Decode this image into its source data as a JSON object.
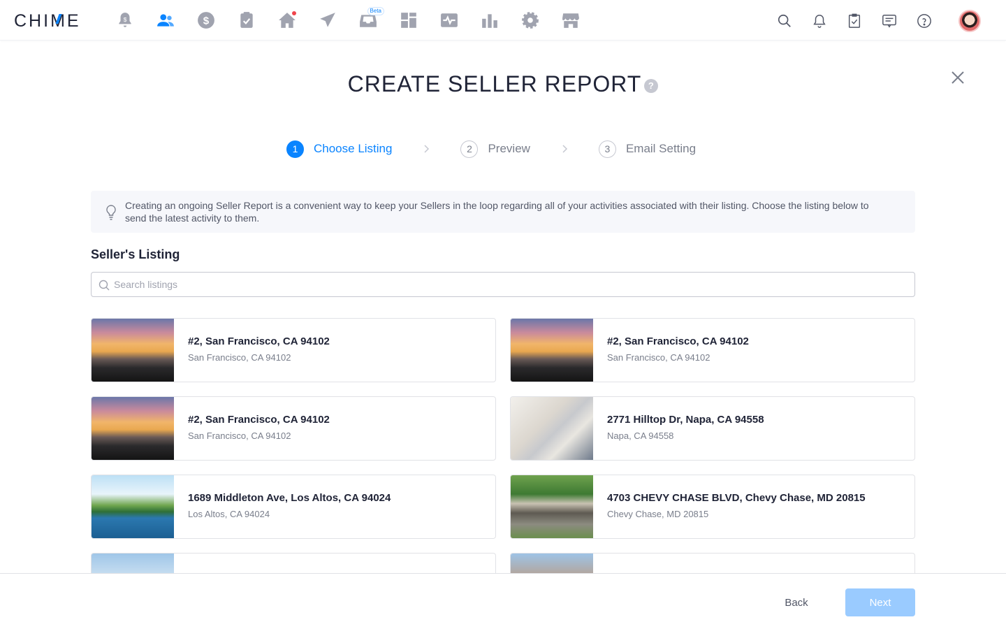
{
  "nav": {
    "logo": "CHIME",
    "icons": [
      "bell-dollar-icon",
      "people-icon",
      "dollar-icon",
      "clipboard-icon",
      "home-icon",
      "send-icon",
      "inbox-icon",
      "dashboard-icon",
      "activity-icon",
      "bar-chart-icon",
      "gear-icon",
      "store-icon"
    ],
    "beta_label": "Beta",
    "active_icon": "people-icon",
    "right_icons": [
      "search-icon",
      "bell-icon",
      "task-icon",
      "message-icon",
      "help-icon"
    ],
    "accent_color": "#0a84ff"
  },
  "header": {
    "title": "CREATE SELLER REPORT",
    "help_glyph": "?"
  },
  "steps": [
    {
      "num": "1",
      "label": "Choose Listing",
      "active": true
    },
    {
      "num": "2",
      "label": "Preview",
      "active": false
    },
    {
      "num": "3",
      "label": "Email Setting",
      "active": false
    }
  ],
  "info": {
    "text": "Creating an ongoing Seller Report is a convenient way to keep your Sellers in the loop regarding all of your activities associated with their listing. Choose the listing below to send the latest activity to them."
  },
  "listing_section": {
    "title": "Seller's Listing",
    "search_placeholder": "Search listings"
  },
  "listings": [
    {
      "address": "#2, San Francisco, CA 94102",
      "city": "San Francisco, CA 94102",
      "image": "sunset"
    },
    {
      "address": "#2, San Francisco, CA 94102",
      "city": "San Francisco, CA 94102",
      "image": "sunset"
    },
    {
      "address": "#2, San Francisco, CA 94102",
      "city": "San Francisco, CA 94102",
      "image": "sunset"
    },
    {
      "address": "2771 Hilltop Dr, Napa, CA 94558",
      "city": "Napa, CA 94558",
      "image": "laptop"
    },
    {
      "address": "1689 Middleton Ave, Los Altos, CA 94024",
      "city": "Los Altos, CA 94024",
      "image": "lake"
    },
    {
      "address": "4703 CHEVY CHASE BLVD, Chevy Chase, MD 20815",
      "city": "Chevy Chase, MD 20815",
      "image": "house"
    },
    {
      "address": "",
      "city": "",
      "image": "street"
    },
    {
      "address": "",
      "city": "",
      "image": "brick"
    }
  ],
  "footer": {
    "back_label": "Back",
    "next_label": "Next"
  }
}
